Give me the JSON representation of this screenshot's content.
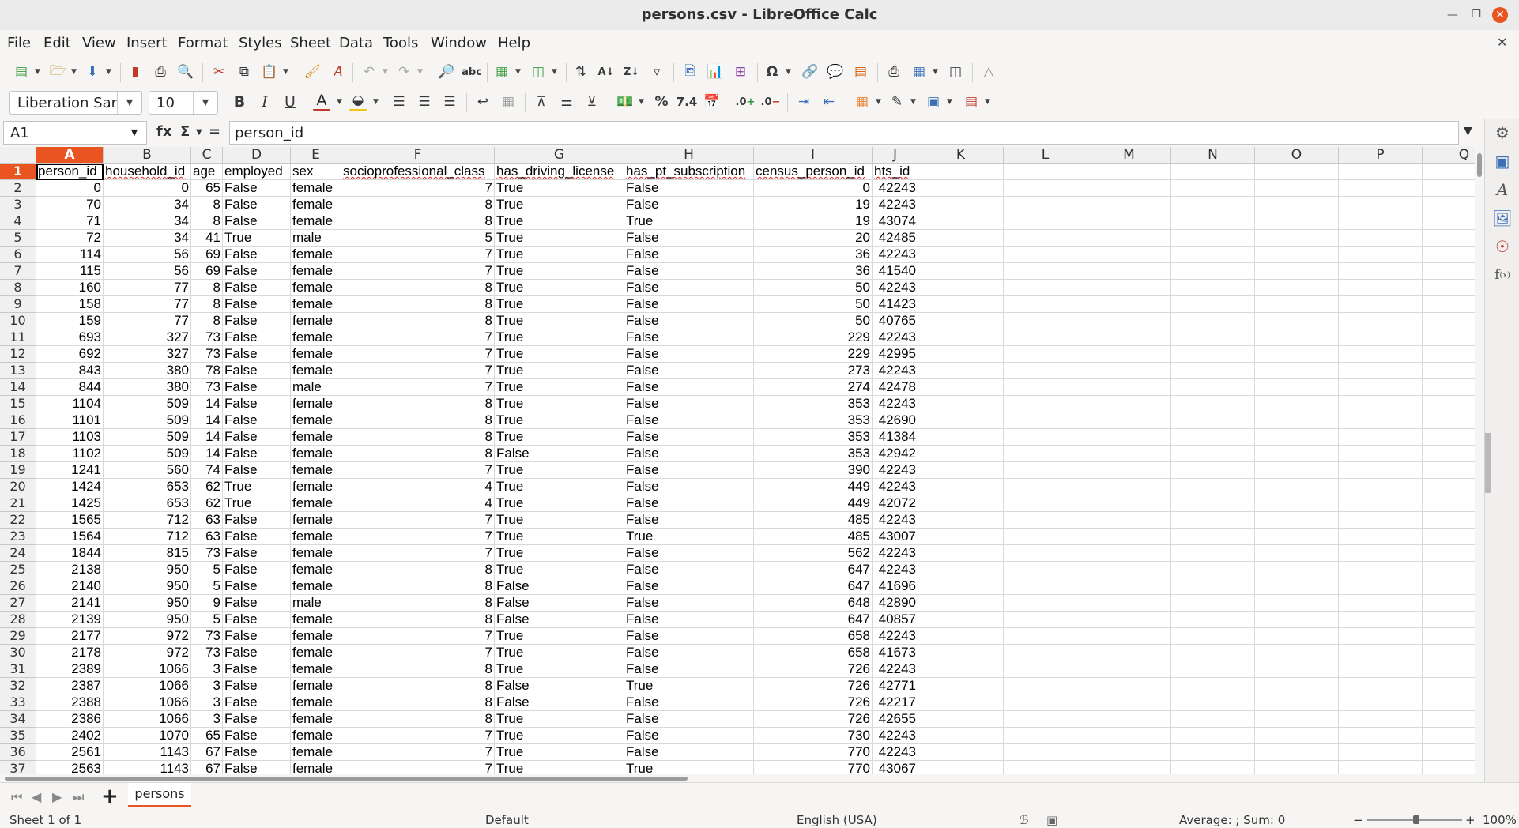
{
  "window": {
    "title": "persons.csv - LibreOffice Calc"
  },
  "menu": [
    "File",
    "Edit",
    "View",
    "Insert",
    "Format",
    "Styles",
    "Sheet",
    "Data",
    "Tools",
    "Window",
    "Help"
  ],
  "font": {
    "name": "Liberation Sar",
    "size": "10"
  },
  "formula_bar": {
    "cell_ref": "A1",
    "content": "person_id",
    "fx": "fx",
    "sum": "Σ",
    "equals": "="
  },
  "columns": [
    "A",
    "B",
    "C",
    "D",
    "E",
    "F",
    "G",
    "H",
    "I",
    "J",
    "K",
    "L",
    "M",
    "N",
    "O",
    "P",
    "Q"
  ],
  "selected_column": "A",
  "selected_row": 1,
  "header_row": [
    "person_id",
    "household_id",
    "age",
    "employed",
    "sex",
    "socioprofessional_class",
    "has_driving_license",
    "has_pt_subscription",
    "census_person_id",
    "hts_id"
  ],
  "rows": [
    [
      "0",
      "0",
      "65",
      "False",
      "female",
      "7",
      "True",
      "False",
      "0",
      "42243"
    ],
    [
      "70",
      "34",
      "8",
      "False",
      "female",
      "8",
      "True",
      "False",
      "19",
      "42243"
    ],
    [
      "71",
      "34",
      "8",
      "False",
      "female",
      "8",
      "True",
      "True",
      "19",
      "43074"
    ],
    [
      "72",
      "34",
      "41",
      "True",
      "male",
      "5",
      "True",
      "False",
      "20",
      "42485"
    ],
    [
      "114",
      "56",
      "69",
      "False",
      "female",
      "7",
      "True",
      "False",
      "36",
      "42243"
    ],
    [
      "115",
      "56",
      "69",
      "False",
      "female",
      "7",
      "True",
      "False",
      "36",
      "41540"
    ],
    [
      "160",
      "77",
      "8",
      "False",
      "female",
      "8",
      "True",
      "False",
      "50",
      "42243"
    ],
    [
      "158",
      "77",
      "8",
      "False",
      "female",
      "8",
      "True",
      "False",
      "50",
      "41423"
    ],
    [
      "159",
      "77",
      "8",
      "False",
      "female",
      "8",
      "True",
      "False",
      "50",
      "40765"
    ],
    [
      "693",
      "327",
      "73",
      "False",
      "female",
      "7",
      "True",
      "False",
      "229",
      "42243"
    ],
    [
      "692",
      "327",
      "73",
      "False",
      "female",
      "7",
      "True",
      "False",
      "229",
      "42995"
    ],
    [
      "843",
      "380",
      "78",
      "False",
      "female",
      "7",
      "True",
      "False",
      "273",
      "42243"
    ],
    [
      "844",
      "380",
      "73",
      "False",
      "male",
      "7",
      "True",
      "False",
      "274",
      "42478"
    ],
    [
      "1104",
      "509",
      "14",
      "False",
      "female",
      "8",
      "True",
      "False",
      "353",
      "42243"
    ],
    [
      "1101",
      "509",
      "14",
      "False",
      "female",
      "8",
      "True",
      "False",
      "353",
      "42690"
    ],
    [
      "1103",
      "509",
      "14",
      "False",
      "female",
      "8",
      "True",
      "False",
      "353",
      "41384"
    ],
    [
      "1102",
      "509",
      "14",
      "False",
      "female",
      "8",
      "False",
      "False",
      "353",
      "42942"
    ],
    [
      "1241",
      "560",
      "74",
      "False",
      "female",
      "7",
      "True",
      "False",
      "390",
      "42243"
    ],
    [
      "1424",
      "653",
      "62",
      "True",
      "female",
      "4",
      "True",
      "False",
      "449",
      "42243"
    ],
    [
      "1425",
      "653",
      "62",
      "True",
      "female",
      "4",
      "True",
      "False",
      "449",
      "42072"
    ],
    [
      "1565",
      "712",
      "63",
      "False",
      "female",
      "7",
      "True",
      "False",
      "485",
      "42243"
    ],
    [
      "1564",
      "712",
      "63",
      "False",
      "female",
      "7",
      "True",
      "True",
      "485",
      "43007"
    ],
    [
      "1844",
      "815",
      "73",
      "False",
      "female",
      "7",
      "True",
      "False",
      "562",
      "42243"
    ],
    [
      "2138",
      "950",
      "5",
      "False",
      "female",
      "8",
      "True",
      "False",
      "647",
      "42243"
    ],
    [
      "2140",
      "950",
      "5",
      "False",
      "female",
      "8",
      "False",
      "False",
      "647",
      "41696"
    ],
    [
      "2141",
      "950",
      "9",
      "False",
      "male",
      "8",
      "False",
      "False",
      "648",
      "42890"
    ],
    [
      "2139",
      "950",
      "5",
      "False",
      "female",
      "8",
      "False",
      "False",
      "647",
      "40857"
    ],
    [
      "2177",
      "972",
      "73",
      "False",
      "female",
      "7",
      "True",
      "False",
      "658",
      "42243"
    ],
    [
      "2178",
      "972",
      "73",
      "False",
      "female",
      "7",
      "True",
      "False",
      "658",
      "41673"
    ],
    [
      "2389",
      "1066",
      "3",
      "False",
      "female",
      "8",
      "True",
      "False",
      "726",
      "42243"
    ],
    [
      "2387",
      "1066",
      "3",
      "False",
      "female",
      "8",
      "False",
      "True",
      "726",
      "42771"
    ],
    [
      "2388",
      "1066",
      "3",
      "False",
      "female",
      "8",
      "False",
      "False",
      "726",
      "42217"
    ],
    [
      "2386",
      "1066",
      "3",
      "False",
      "female",
      "8",
      "True",
      "False",
      "726",
      "42655"
    ],
    [
      "2402",
      "1070",
      "65",
      "False",
      "female",
      "7",
      "True",
      "False",
      "730",
      "42243"
    ],
    [
      "2561",
      "1143",
      "67",
      "False",
      "female",
      "7",
      "True",
      "False",
      "770",
      "42243"
    ],
    [
      "2563",
      "1143",
      "67",
      "False",
      "female",
      "7",
      "True",
      "True",
      "770",
      "43067"
    ]
  ],
  "sheet_tabs": [
    "persons"
  ],
  "status": {
    "sheet": "Sheet 1 of 1",
    "page_style": "Default",
    "language": "English (USA)",
    "summary": "Average: ; Sum: 0",
    "zoom": "100%"
  },
  "icons": {
    "toolbar1": [
      "new-document-icon",
      "open-icon",
      "save-icon",
      "export-pdf-icon",
      "print-icon",
      "print-preview-icon",
      "cut-icon",
      "copy-icon",
      "paste-icon",
      "clone-formatting-icon",
      "clear-formatting-icon",
      "undo-icon",
      "redo-icon",
      "find-replace-icon",
      "spelling-icon",
      "row-icon",
      "column-icon",
      "sort-icon",
      "sort-ascending-icon",
      "sort-descending-icon",
      "autofilter-icon",
      "insert-image-icon",
      "insert-chart-icon",
      "pivot-table-icon",
      "special-character-icon",
      "hyperlink-icon",
      "comment-icon",
      "headers-footers-icon",
      "print-area-icon",
      "freeze-rows-columns-icon",
      "split-window-icon",
      "draw-functions-icon"
    ],
    "accent_color": "#e95420"
  }
}
